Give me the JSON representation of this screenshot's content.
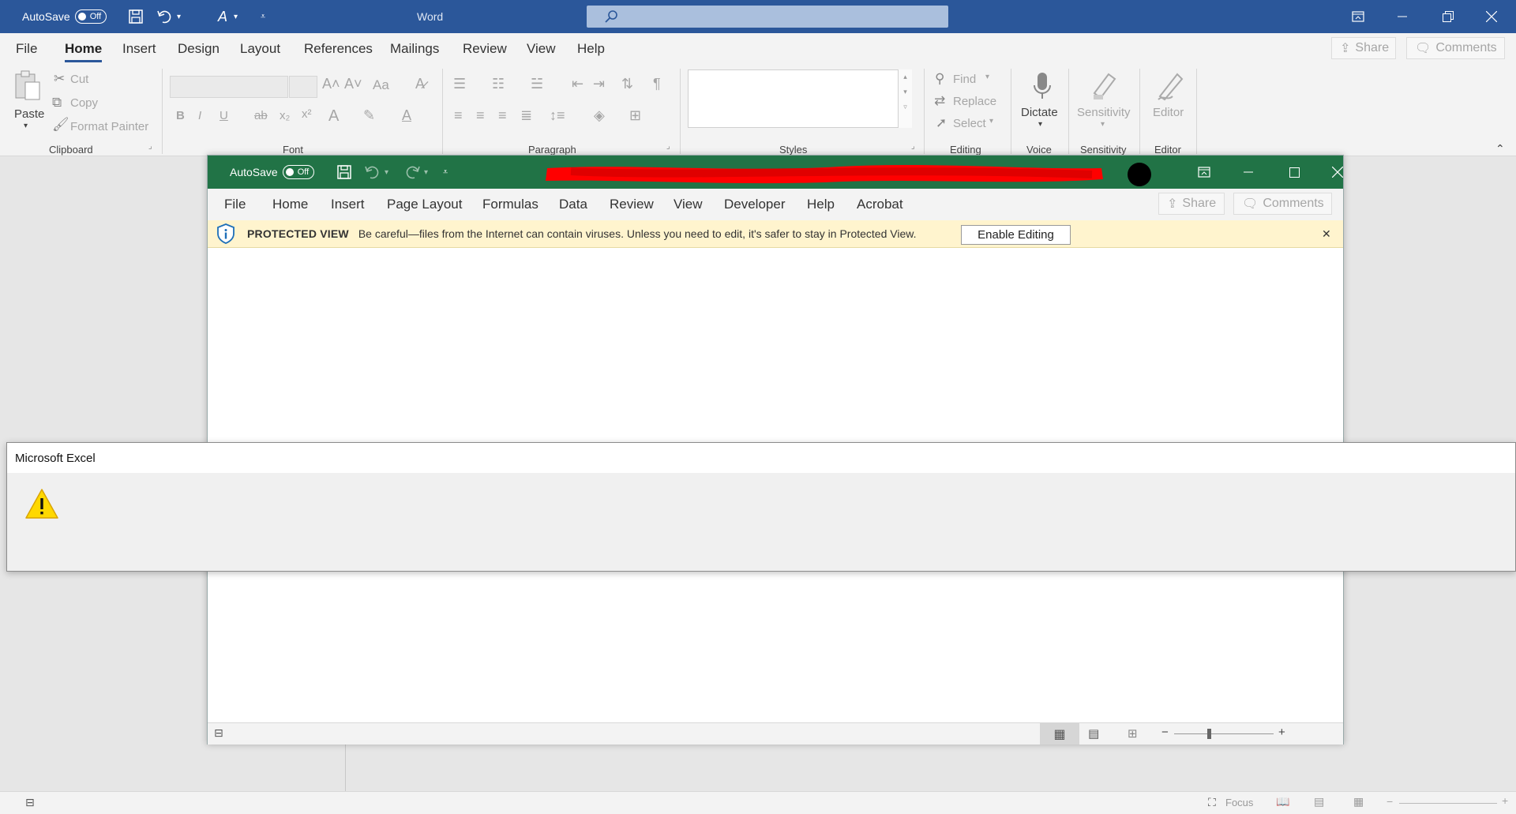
{
  "word": {
    "title": "Word",
    "autosave_label": "AutoSave",
    "autosave_state": "Off",
    "tabs": [
      "File",
      "Home",
      "Insert",
      "Design",
      "Layout",
      "References",
      "Mailings",
      "Review",
      "View",
      "Help"
    ],
    "active_tab": "Home",
    "share_label": "Share",
    "comments_label": "Comments",
    "ribbon": {
      "clipboard": {
        "label": "Clipboard",
        "paste": "Paste",
        "cut": "Cut",
        "copy": "Copy",
        "format_painter": "Format Painter"
      },
      "font": {
        "label": "Font",
        "change_case": "Aa"
      },
      "paragraph": {
        "label": "Paragraph"
      },
      "styles": {
        "label": "Styles"
      },
      "editing": {
        "label": "Editing",
        "find": "Find",
        "replace": "Replace",
        "select": "Select"
      },
      "voice": {
        "label": "Voice",
        "dictate": "Dictate"
      },
      "sensitivity": {
        "label": "Sensitivity",
        "button": "Sensitivity"
      },
      "editor": {
        "label": "Editor",
        "button": "Editor"
      }
    },
    "status": {
      "focus": "Focus"
    }
  },
  "excel": {
    "autosave_label": "AutoSave",
    "autosave_state": "Off",
    "tabs": [
      "File",
      "Home",
      "Insert",
      "Page Layout",
      "Formulas",
      "Data",
      "Review",
      "View",
      "Developer",
      "Help",
      "Acrobat"
    ],
    "share_label": "Share",
    "comments_label": "Comments",
    "protected_view": {
      "title": "PROTECTED VIEW",
      "message": "Be careful—files from the Internet can contain viruses. Unless you need to edit, it's safer to stay in Protected View.",
      "button": "Enable Editing"
    }
  },
  "dialog": {
    "title": "Microsoft Excel",
    "icon": "warning-icon"
  },
  "colors": {
    "word_blue": "#2b579a",
    "excel_green": "#217346",
    "protected_yellow": "#fff4ce",
    "redaction_red": "#ff0000"
  }
}
